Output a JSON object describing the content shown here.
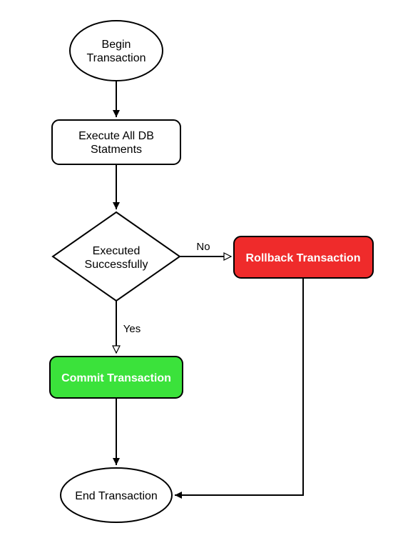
{
  "nodes": {
    "begin": {
      "line1": "Begin",
      "line2": "Transaction"
    },
    "execute": {
      "line1": "Execute All DB",
      "line2": "Statments"
    },
    "decision": {
      "line1": "Executed",
      "line2": "Successfully"
    },
    "rollback": {
      "label": "Rollback Transaction"
    },
    "commit": {
      "label": "Commit Transaction"
    },
    "end": {
      "label": "End Transaction"
    }
  },
  "edges": {
    "no": "No",
    "yes": "Yes"
  },
  "colors": {
    "rollback": "#ef2b2b",
    "commit": "#3be23b"
  }
}
